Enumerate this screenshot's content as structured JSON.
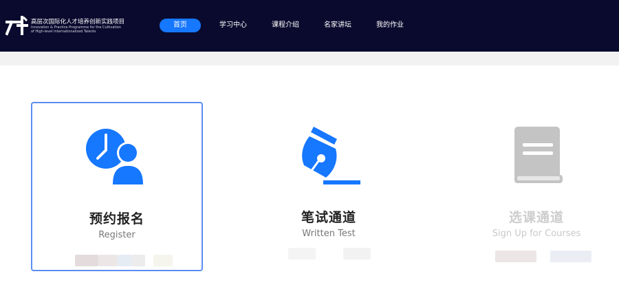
{
  "header": {
    "logo_title_cn": "高层次国际化人才培养创新实践项目",
    "logo_subtitle_line1": "Innovation & Practice Programme for the Cultivation",
    "logo_subtitle_line2": "of High-level Internationalized Talents"
  },
  "nav": {
    "items": [
      {
        "label": "首页",
        "active": true
      },
      {
        "label": "学习中心"
      },
      {
        "label": "课程介绍"
      },
      {
        "label": "名家讲坛"
      },
      {
        "label": "我的作业"
      }
    ]
  },
  "cards": [
    {
      "title": "预约报名",
      "subtitle": "Register",
      "icon": "register-user-clock-icon",
      "selected": true,
      "enabled": true
    },
    {
      "title": "笔试通道",
      "subtitle": "Written Test",
      "icon": "pen-nib-icon",
      "enabled": true
    },
    {
      "title": "选课通道",
      "subtitle": "Sign Up for Courses",
      "icon": "book-icon",
      "enabled": false
    }
  ],
  "colors": {
    "header_bg": "#0a0a2e",
    "accent_blue": "#1677ff",
    "card_border": "#5b8def",
    "disabled_gray": "#cdcdcd"
  }
}
